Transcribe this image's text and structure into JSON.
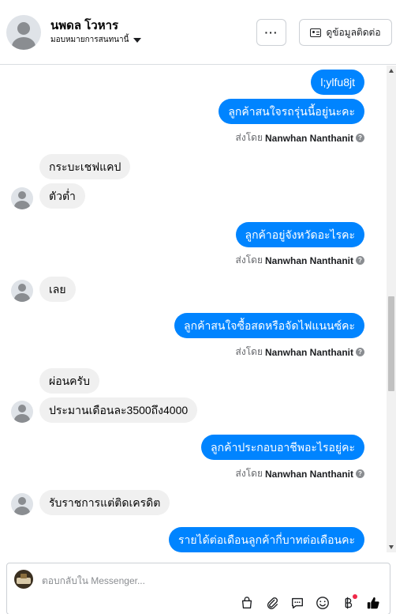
{
  "header": {
    "contact_name": "นพดล โวหาร",
    "assign_label": "มอบหมายการสนทนานี้",
    "more_label": "···",
    "contact_info_label": "ดูข้อมูลติดต่อ"
  },
  "thread": {
    "messages": [
      {
        "text": "l;ylfu8jt"
      },
      {
        "text": "ลูกค้าสนใจรถรุ่นนี้อยู่นะคะ"
      },
      {
        "text": "กระบะเชฟแคป"
      },
      {
        "text": "ตัวต่ำ"
      },
      {
        "text": "ลูกค้าอยู่จังหวัดอะไรคะ"
      },
      {
        "text": "เลย"
      },
      {
        "text": "ลูกค้าสนใจซื้อสดหรือจัดไฟแนนซ์คะ"
      },
      {
        "text": "ผ่อนครับ"
      },
      {
        "text": "ประมานเดือนละ3500ถึง4000"
      },
      {
        "text": "ลูกค้าประกอบอาชีพอะไรอยู่คะ"
      },
      {
        "text": "รับราชการแต่ติดเครดิต"
      },
      {
        "text": "รายได้ต่อเดือนลูกค้ากี่บาทต่อเดือนคะ"
      }
    ],
    "sent_by_prefix": "ส่งโดย",
    "sender_name": "Nanwhan Nanthanit"
  },
  "composer": {
    "placeholder": "ตอบกลับใน Messenger..."
  },
  "icons": [
    "shopping-bag-icon",
    "attachment-icon",
    "saved-reply-icon",
    "emoji-icon",
    "baht-payment-icon",
    "thumbs-up-icon"
  ],
  "colors": {
    "outgoing_bubble": "#0084ff",
    "incoming_bubble": "#f0f0f0",
    "notification_dot": "#f02849",
    "like_icon": "#050505"
  }
}
